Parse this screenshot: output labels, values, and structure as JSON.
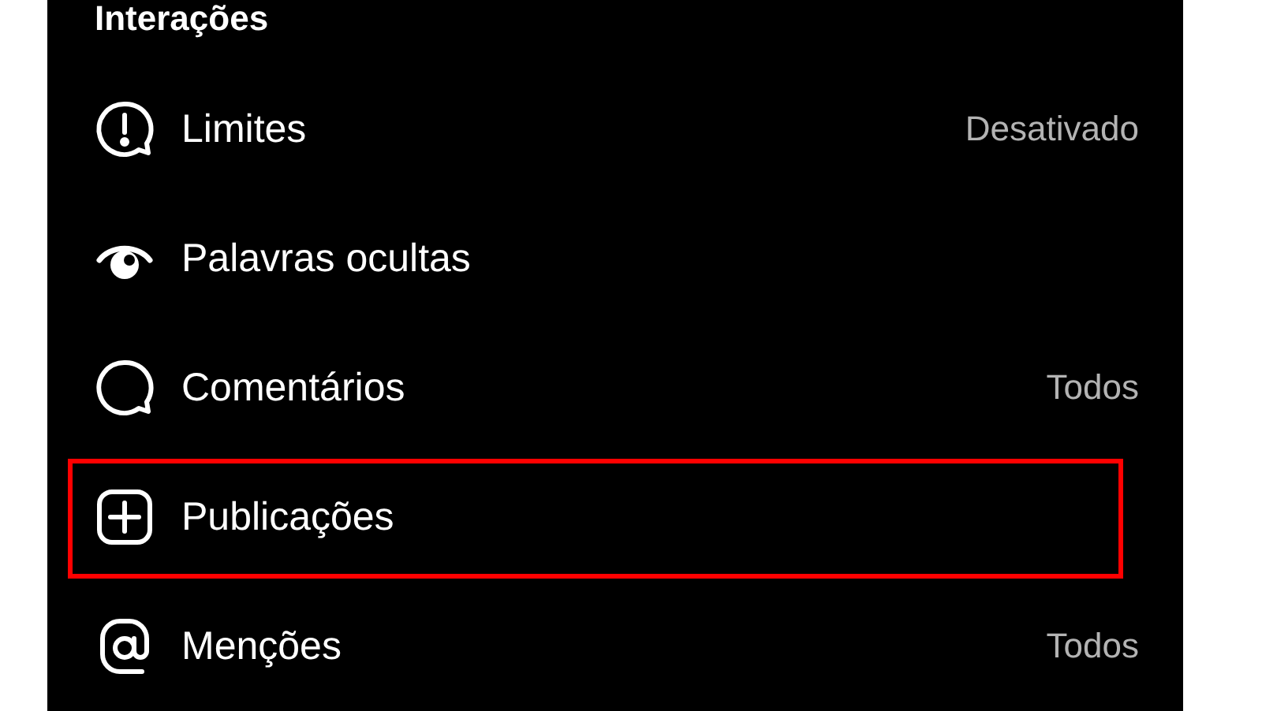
{
  "section_title": "Interações",
  "items": [
    {
      "label": "Limites",
      "value": "Desativado",
      "highlighted": false
    },
    {
      "label": "Palavras ocultas",
      "highlighted": false
    },
    {
      "label": "Comentários",
      "value": "Todos",
      "highlighted": false
    },
    {
      "label": "Publicações",
      "highlighted": true
    },
    {
      "label": "Menções",
      "value": "Todos",
      "highlighted": false
    }
  ]
}
